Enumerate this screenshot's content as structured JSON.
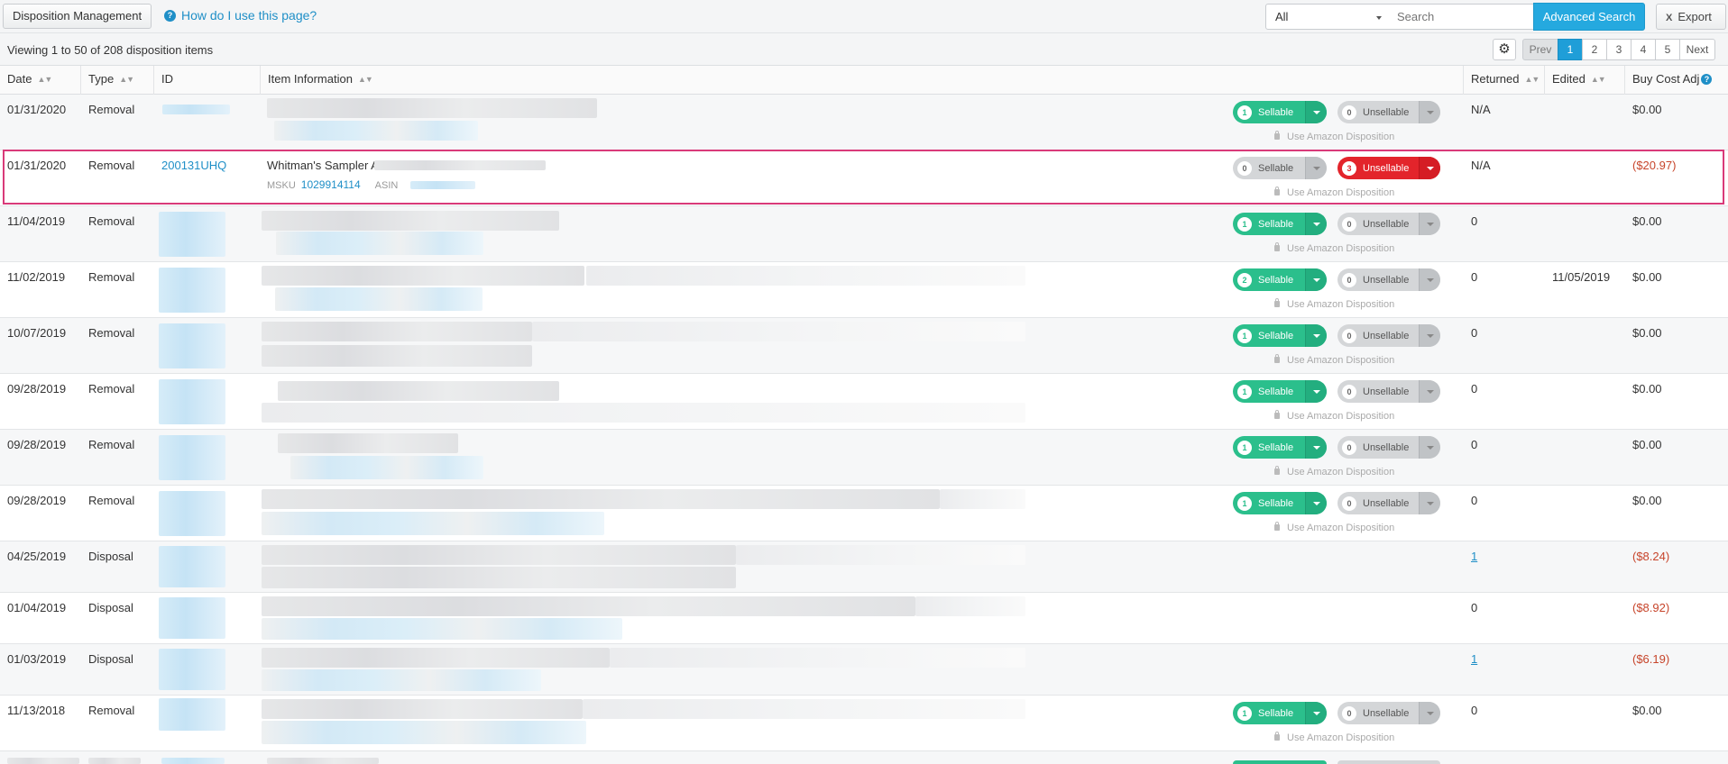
{
  "toolbar": {
    "title_button": "Disposition Management",
    "help_link": "How do I use this page?",
    "filter_select": "All",
    "search_placeholder": "Search",
    "advanced_search": "Advanced Search",
    "export": "Export",
    "export_icon": "X"
  },
  "subbar": {
    "viewing": "Viewing 1 to 50 of 208 disposition items",
    "settings_icon": "gear-icon",
    "pager": {
      "prev": "Prev",
      "pages": [
        "1",
        "2",
        "3",
        "4",
        "5"
      ],
      "active": "1",
      "next": "Next"
    }
  },
  "columns": {
    "date": "Date",
    "type": "Type",
    "id": "ID",
    "item_information": "Item Information",
    "returned": "Returned",
    "edited": "Edited",
    "buy_cost_adj": "Buy Cost Adj"
  },
  "labels": {
    "sellable": "Sellable",
    "unsellable": "Unsellable",
    "use_amazon": "Use Amazon Disposition",
    "msku": "MSKU",
    "asin": "ASIN"
  },
  "rows": [
    {
      "date": "01/31/2020",
      "type": "Removal",
      "sellable": "1",
      "unsellable": "0",
      "returned": "N/A",
      "edited": "",
      "cost": "$0.00"
    },
    {
      "date": "01/31/2020",
      "type": "Removal",
      "id": "200131UHQ",
      "title": "Whitman's Sampler A",
      "msku": "1029914114",
      "sellable": "0",
      "unsellable": "3",
      "returned": "N/A",
      "edited": "",
      "cost": "($20.97)"
    },
    {
      "date": "11/04/2019",
      "type": "Removal",
      "sellable": "1",
      "unsellable": "0",
      "returned": "0",
      "edited": "",
      "cost": "$0.00"
    },
    {
      "date": "11/02/2019",
      "type": "Removal",
      "sellable": "2",
      "unsellable": "0",
      "returned": "0",
      "edited": "11/05/2019",
      "cost": "$0.00"
    },
    {
      "date": "10/07/2019",
      "type": "Removal",
      "sellable": "1",
      "unsellable": "0",
      "returned": "0",
      "edited": "",
      "cost": "$0.00"
    },
    {
      "date": "09/28/2019",
      "type": "Removal",
      "sellable": "1",
      "unsellable": "0",
      "returned": "0",
      "edited": "",
      "cost": "$0.00"
    },
    {
      "date": "09/28/2019",
      "type": "Removal",
      "sellable": "1",
      "unsellable": "0",
      "returned": "0",
      "edited": "",
      "cost": "$0.00"
    },
    {
      "date": "09/28/2019",
      "type": "Removal",
      "sellable": "1",
      "unsellable": "0",
      "returned": "0",
      "edited": "",
      "cost": "$0.00"
    },
    {
      "date": "04/25/2019",
      "type": "Disposal",
      "returned": "1",
      "edited": "",
      "cost": "($8.24)"
    },
    {
      "date": "01/04/2019",
      "type": "Disposal",
      "returned": "0",
      "edited": "",
      "cost": "($8.92)"
    },
    {
      "date": "01/03/2019",
      "type": "Disposal",
      "returned": "1",
      "edited": "",
      "cost": "($6.19)"
    },
    {
      "date": "11/13/2018",
      "type": "Removal",
      "sellable": "1",
      "unsellable": "0",
      "returned": "0",
      "edited": "",
      "cost": "$0.00"
    }
  ]
}
